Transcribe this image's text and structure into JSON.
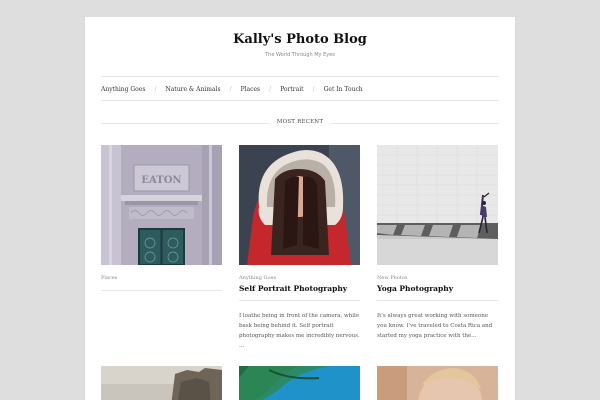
{
  "site": {
    "title": "Kally's Photo Blog",
    "tagline": "The World Through My Eyes"
  },
  "nav": {
    "items": [
      "Anything Goes",
      "Nature & Animals",
      "Places",
      "Portrait",
      "Get In Touch"
    ],
    "separator": "/"
  },
  "section": {
    "label": "MOST RECENT"
  },
  "posts": [
    {
      "category": "Places",
      "title": "",
      "excerpt": ""
    },
    {
      "category": "Anything Goes",
      "title": "Self Portrait Photography",
      "excerpt": "I loathe being in front of the camera, while bask being behind it. Self portrait photography makes me incredibly nervous. …"
    },
    {
      "category": "New Photos",
      "title": "Yoga Photography",
      "excerpt": "It's always great working with someone you know. I've traveled to Costa Rica and started my yoga practice with the..."
    }
  ],
  "colors": {
    "background": "#dedede",
    "card": "#ffffff",
    "rule": "#e6e6e6"
  }
}
